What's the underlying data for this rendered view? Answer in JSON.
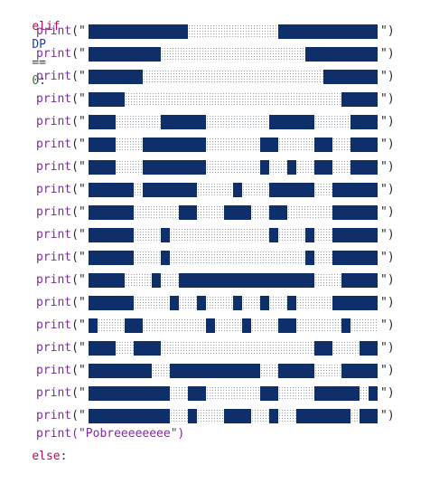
{
  "code": {
    "elif_keyword": "elif",
    "elif_var": "DP",
    "elif_op": "==",
    "elif_num": "0",
    "elif_colon": ":",
    "print_fn": "print",
    "open_quote": "(\"",
    "close_quote": "\")",
    "final_print": "print(\"Pobreeeeeeee\")",
    "else_keyword": "else",
    "else_colon": ":"
  },
  "colors": {
    "block_solid": "#0f2f6b",
    "block_dot": "#9aa2ad",
    "keyword": "#a3125a",
    "function": "#7b2d9a"
  },
  "art_rows": [
    [
      [
        "s",
        0,
        11
      ],
      [
        "d",
        11,
        21
      ],
      [
        "s",
        21,
        32
      ]
    ],
    [
      [
        "s",
        0,
        8
      ],
      [
        "d",
        8,
        24
      ],
      [
        "s",
        24,
        32
      ]
    ],
    [
      [
        "s",
        0,
        6
      ],
      [
        "d",
        6,
        26
      ],
      [
        "s",
        26,
        32
      ]
    ],
    [
      [
        "s",
        0,
        4
      ],
      [
        "d",
        4,
        28
      ],
      [
        "s",
        28,
        32
      ]
    ],
    [
      [
        "s",
        0,
        3
      ],
      [
        "d",
        3,
        8
      ],
      [
        "s",
        8,
        13
      ],
      [
        "d",
        13,
        20
      ],
      [
        "s",
        20,
        25
      ],
      [
        "d",
        25,
        29
      ],
      [
        "s",
        29,
        32
      ]
    ],
    [
      [
        "s",
        0,
        3
      ],
      [
        "d",
        3,
        6
      ],
      [
        "s",
        6,
        13
      ],
      [
        "d",
        13,
        19
      ],
      [
        "s",
        19,
        21
      ],
      [
        "d",
        21,
        25
      ],
      [
        "s",
        25,
        27
      ],
      [
        "d",
        27,
        29
      ],
      [
        "s",
        29,
        32
      ]
    ],
    [
      [
        "s",
        0,
        3
      ],
      [
        "d",
        3,
        6
      ],
      [
        "s",
        6,
        13
      ],
      [
        "d",
        13,
        19
      ],
      [
        "s",
        19,
        20
      ],
      [
        "d",
        20,
        22
      ],
      [
        "s",
        22,
        23
      ],
      [
        "d",
        23,
        25
      ],
      [
        "s",
        25,
        27
      ],
      [
        "d",
        27,
        29
      ],
      [
        "s",
        29,
        32
      ]
    ],
    [
      [
        "s",
        0,
        5
      ],
      [
        "d",
        5,
        6
      ],
      [
        "s",
        6,
        12
      ],
      [
        "d",
        12,
        16
      ],
      [
        "s",
        16,
        17
      ],
      [
        "d",
        17,
        20
      ],
      [
        "s",
        20,
        25
      ],
      [
        "d",
        25,
        27
      ],
      [
        "s",
        27,
        32
      ]
    ],
    [
      [
        "s",
        0,
        5
      ],
      [
        "d",
        5,
        10
      ],
      [
        "s",
        10,
        12
      ],
      [
        "d",
        12,
        15
      ],
      [
        "s",
        15,
        18
      ],
      [
        "d",
        18,
        20
      ],
      [
        "s",
        20,
        22
      ],
      [
        "d",
        22,
        27
      ],
      [
        "s",
        27,
        32
      ]
    ],
    [
      [
        "s",
        0,
        5
      ],
      [
        "d",
        5,
        8
      ],
      [
        "s",
        8,
        9
      ],
      [
        "d",
        9,
        20
      ],
      [
        "s",
        20,
        21
      ],
      [
        "d",
        21,
        24
      ],
      [
        "s",
        24,
        25
      ],
      [
        "d",
        25,
        27
      ],
      [
        "s",
        27,
        32
      ]
    ],
    [
      [
        "s",
        0,
        5
      ],
      [
        "d",
        5,
        8
      ],
      [
        "s",
        8,
        9
      ],
      [
        "d",
        9,
        24
      ],
      [
        "s",
        24,
        25
      ],
      [
        "d",
        25,
        27
      ],
      [
        "s",
        27,
        32
      ]
    ],
    [
      [
        "s",
        0,
        4
      ],
      [
        "d",
        4,
        7
      ],
      [
        "s",
        7,
        8
      ],
      [
        "d",
        8,
        10
      ],
      [
        "s",
        10,
        25
      ],
      [
        "d",
        25,
        28
      ],
      [
        "s",
        28,
        32
      ]
    ],
    [
      [
        "s",
        0,
        5
      ],
      [
        "d",
        5,
        9
      ],
      [
        "s",
        9,
        10
      ],
      [
        "d",
        10,
        12
      ],
      [
        "s",
        12,
        13
      ],
      [
        "d",
        13,
        16
      ],
      [
        "s",
        16,
        17
      ],
      [
        "d",
        17,
        19
      ],
      [
        "s",
        19,
        20
      ],
      [
        "d",
        20,
        22
      ],
      [
        "s",
        22,
        23
      ],
      [
        "d",
        23,
        27
      ],
      [
        "s",
        27,
        32
      ]
    ],
    [
      [
        "s",
        0,
        1
      ],
      [
        "d",
        1,
        4
      ],
      [
        "s",
        4,
        6
      ],
      [
        "d",
        6,
        13
      ],
      [
        "s",
        13,
        14
      ],
      [
        "d",
        14,
        17
      ],
      [
        "s",
        17,
        18
      ],
      [
        "d",
        18,
        21
      ],
      [
        "s",
        21,
        23
      ],
      [
        "d",
        23,
        28
      ],
      [
        "s",
        28,
        29
      ],
      [
        "d",
        29,
        32
      ]
    ],
    [
      [
        "s",
        0,
        3
      ],
      [
        "d",
        3,
        5
      ],
      [
        "s",
        5,
        8
      ],
      [
        "d",
        8,
        25
      ],
      [
        "s",
        25,
        27
      ],
      [
        "d",
        27,
        30
      ],
      [
        "s",
        30,
        32
      ]
    ],
    [
      [
        "s",
        0,
        7
      ],
      [
        "d",
        7,
        9
      ],
      [
        "s",
        9,
        19
      ],
      [
        "d",
        19,
        21
      ],
      [
        "s",
        21,
        25
      ],
      [
        "d",
        25,
        28
      ],
      [
        "s",
        28,
        32
      ]
    ],
    [
      [
        "s",
        0,
        9
      ],
      [
        "d",
        9,
        11
      ],
      [
        "s",
        11,
        13
      ],
      [
        "d",
        13,
        19
      ],
      [
        "s",
        19,
        21
      ],
      [
        "d",
        21,
        25
      ],
      [
        "s",
        25,
        30
      ],
      [
        "d",
        30,
        31
      ],
      [
        "s",
        31,
        32
      ]
    ],
    [
      [
        "s",
        0,
        9
      ],
      [
        "d",
        9,
        11
      ],
      [
        "s",
        11,
        12
      ],
      [
        "d",
        12,
        15
      ],
      [
        "s",
        15,
        18
      ],
      [
        "d",
        18,
        20
      ],
      [
        "s",
        20,
        21
      ],
      [
        "d",
        21,
        23
      ],
      [
        "s",
        23,
        29
      ],
      [
        "d",
        29,
        30
      ],
      [
        "s",
        30,
        32
      ]
    ]
  ]
}
